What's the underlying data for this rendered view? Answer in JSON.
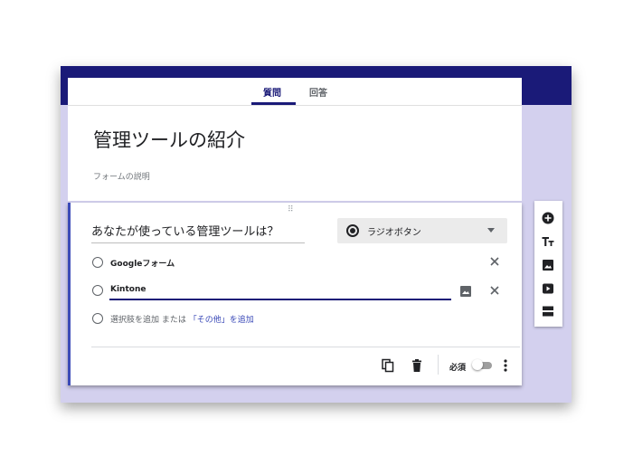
{
  "tabs": {
    "questions": "質問",
    "responses": "回答"
  },
  "form": {
    "title": "管理ツールの紹介",
    "description_placeholder": "フォームの説明"
  },
  "question": {
    "title": "あなたが使っている管理ツールは？",
    "type_label": "ラジオボタン",
    "options": [
      "Googleフォーム",
      "Kintone"
    ],
    "add_option": "選択肢を追加",
    "or_text": "または",
    "add_other": "「その他」を追加",
    "required_label": "必須",
    "required": false
  },
  "colors": {
    "header": "#1a1a78",
    "background": "#d3d0ee",
    "accent": "#3b4ab8"
  },
  "icons": {
    "side_toolbar": [
      "add-question-icon",
      "add-title-icon",
      "add-image-icon",
      "add-video-icon",
      "add-section-icon"
    ],
    "footer": [
      "copy-icon",
      "trash-icon",
      "more-vert-icon"
    ]
  }
}
